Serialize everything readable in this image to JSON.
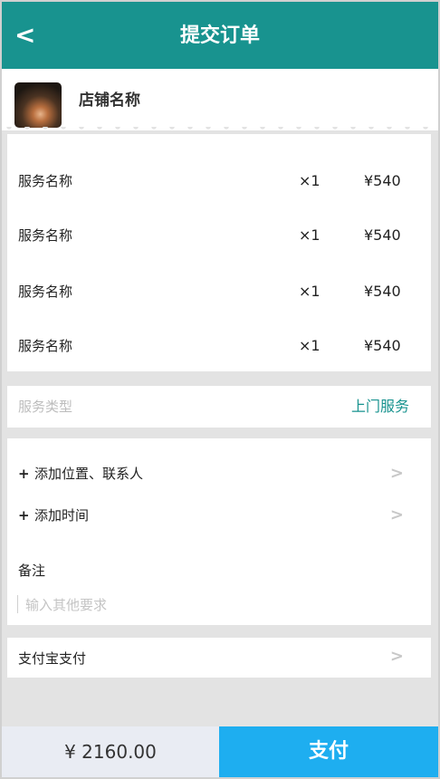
{
  "header": {
    "back_label": "<",
    "title": "提交订单"
  },
  "shop": {
    "name": "店铺名称"
  },
  "items": [
    {
      "name": "服务名称",
      "qty": "×1",
      "price": "¥540"
    },
    {
      "name": "服务名称",
      "qty": "×1",
      "price": "¥540"
    },
    {
      "name": "服务名称",
      "qty": "×1",
      "price": "¥540"
    },
    {
      "name": "服务名称",
      "qty": "×1",
      "price": "¥540"
    }
  ],
  "service_type": {
    "label": "服务类型",
    "value": "上门服务"
  },
  "options": {
    "plus": "+",
    "add_location": "添加位置、联系人",
    "add_time": "添加时间",
    "chevron": ">"
  },
  "note": {
    "label": "备注",
    "placeholder": "输入其他要求"
  },
  "payment": {
    "method": "支付宝支付"
  },
  "footer": {
    "total": "¥ 2160.00",
    "pay_label": "支付"
  },
  "colors": {
    "header": "#18938f",
    "accent_text": "#18938f",
    "pay_button": "#1eaef0",
    "total_bg": "#e9ecf3"
  }
}
